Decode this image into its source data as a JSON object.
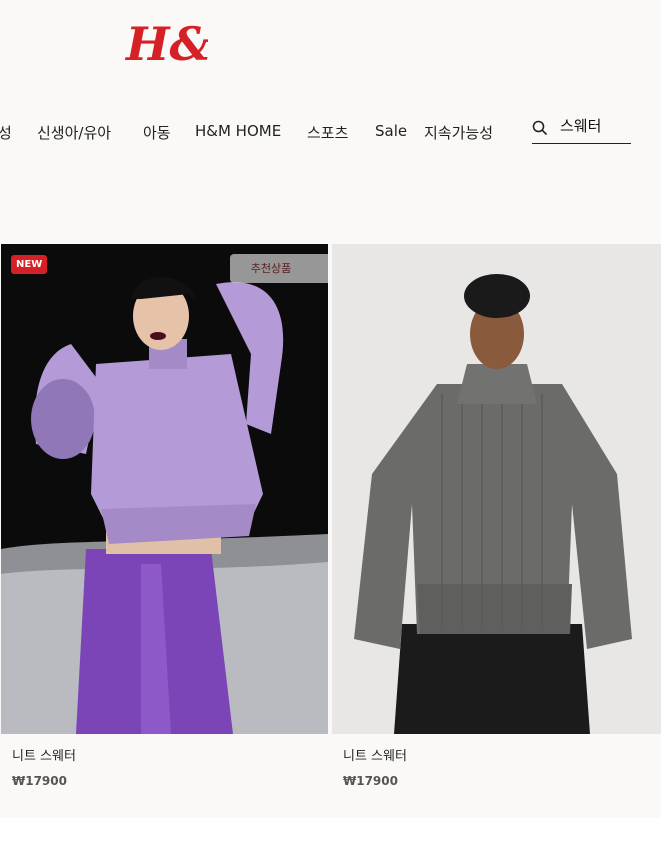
{
  "brand": {
    "logo_text": "H&M",
    "logo_color": "#d52026"
  },
  "nav": {
    "items": [
      {
        "label": "성"
      },
      {
        "label": "신생아/유아"
      },
      {
        "label": "아동"
      },
      {
        "label": "H&M HOME"
      },
      {
        "label": "스포츠"
      },
      {
        "label": "Sale"
      },
      {
        "label": "지속가능성"
      }
    ]
  },
  "search": {
    "icon": "search-icon",
    "value": "스웨터"
  },
  "products": [
    {
      "badge_new": "NEW",
      "badge_recommend": "추천상품",
      "name": "니트 스웨터",
      "price": "₩17900",
      "image_colors": {
        "sweater": "#b49ad6",
        "pants": "#7b45b8",
        "background": "#0b0b0b"
      }
    },
    {
      "name": "니트 스웨터",
      "price": "₩17900",
      "image_colors": {
        "sweater": "#6b6b6a",
        "pants": "#1b1b1b",
        "background": "#e8e7e6"
      }
    }
  ]
}
